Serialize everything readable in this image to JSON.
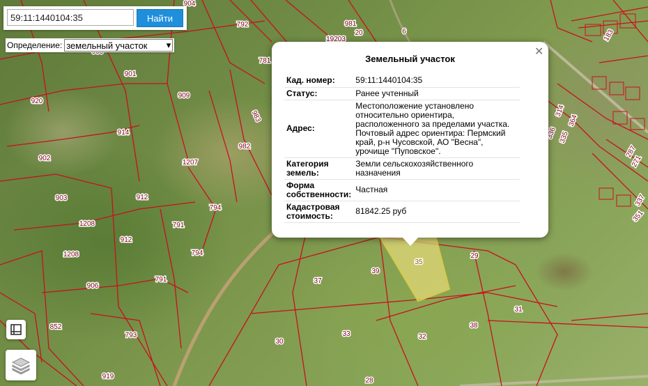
{
  "search": {
    "value": "59:11:1440104:35",
    "button_label": "Найти"
  },
  "definition": {
    "label": "Определение:",
    "selected": "земельный участок"
  },
  "popup": {
    "title": "Земельный участок",
    "rows": [
      {
        "key": "Кад. номер:",
        "value": "59:11:1440104:35"
      },
      {
        "key": "Статус:",
        "value": "Ранее учтенный"
      },
      {
        "key": "Адрес:",
        "value": "Местоположение установлено относительно ориентира, расположенного за пределами участка. Почтовый адрес ориентира: Пермский край, р-н Чусовской, АО \"Весна\", урочище \"Пуповское\"."
      },
      {
        "key": "Категория земель:",
        "value": "Земли сельскохозяйственного назначения"
      },
      {
        "key": "Форма собственности:",
        "value": "Частная"
      },
      {
        "key": "Кадастровая стоимость:",
        "value": "81842.25 руб"
      }
    ]
  },
  "parcel_labels": [
    "904",
    "792",
    "981",
    "20",
    "19203",
    "6",
    "905",
    "781",
    "183",
    "901",
    "909",
    "920",
    "983",
    "914",
    "982",
    "902",
    "1207",
    "336",
    "364",
    "335",
    "314",
    "287",
    "271",
    "903",
    "912",
    "794",
    "791",
    "1208",
    "912",
    "337",
    "351",
    "1208",
    "794",
    "906",
    "791",
    "37",
    "39",
    "35",
    "29",
    "31",
    "33",
    "32",
    "38",
    "852",
    "793",
    "30",
    "919",
    "28"
  ],
  "icons": {
    "close": "close-icon",
    "legend": "legend-icon",
    "layers": "layers-icon"
  },
  "colors": {
    "boundary": "#c8101e",
    "selected_fill": "#e8dc7a",
    "button": "#1f8fdb"
  }
}
